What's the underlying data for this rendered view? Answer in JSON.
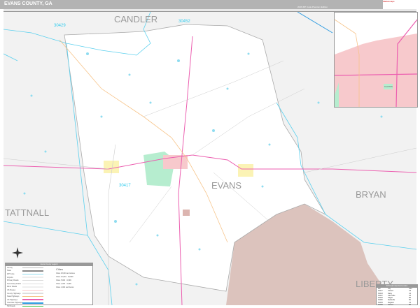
{
  "header": {
    "title": "EVANS COUNTY, GA",
    "edition": "2026 ZIP Code Premium Edition",
    "logo_text": "Marketmaps"
  },
  "colors": {
    "zip_pink": "#f7c9cc",
    "zip_green": "#b6edcf",
    "zip_yellow": "#fbf3b5",
    "fort_brown": "#dcc3bd",
    "water": "#8fdcf0",
    "highway": "#ec5fb0",
    "road_orange": "#f7c48a",
    "zip_line": "#5bd0ee"
  },
  "map": {
    "counties": [
      "CANDLER",
      "TATTNALL",
      "EVANS",
      "BRYAN",
      "LIBERTY"
    ],
    "zip_codes": [
      "30429",
      "30452",
      "30417"
    ]
  },
  "legend": {
    "title": "Evans County Legend",
    "items": [
      "County",
      "State",
      "ZIP Code",
      "Airports",
      "Primary Roads",
      "Secondary Roads",
      "Minor Roads",
      "US Routes",
      "County Highways",
      "State Highways",
      "US Highways",
      "Interstate Highways",
      "Toll Roads"
    ],
    "population_title": "Cities",
    "population_items": [
      "Cities 25,000 and above",
      "Cities 10,000 - 24,999",
      "Cities 5,000 - 9,999",
      "Cities 1,000 - 4,999",
      "Cities 1,000 and below"
    ]
  },
  "zip_table": {
    "title": "ZIP Code Index/Grid Locator",
    "headers": [
      "ZIP",
      "City",
      "Grid"
    ],
    "rows": [
      [
        "30417",
        "Claxton",
        "C3"
      ],
      [
        "30423",
        "Daisy",
        "C4"
      ],
      [
        "30427",
        "Glennville",
        "A3"
      ],
      [
        "30429",
        "Hagan",
        "B3"
      ],
      [
        "30452",
        "Reidsville",
        "B1"
      ],
      [
        "30453",
        "Register",
        "C1"
      ],
      [
        "30499",
        "Claxton",
        "B3"
      ]
    ]
  },
  "inset": {
    "label": "CLAXTON"
  }
}
